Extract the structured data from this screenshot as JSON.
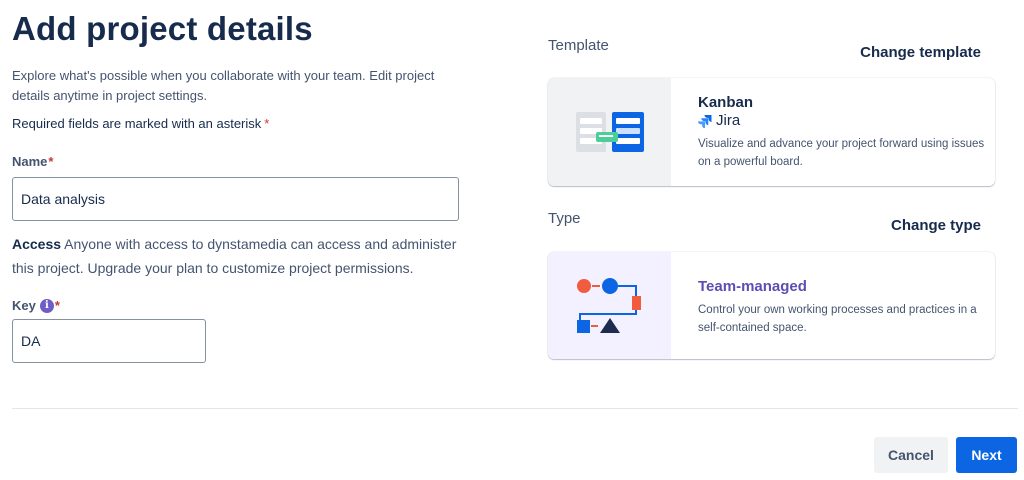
{
  "header": {
    "title": "Add project details",
    "intro": "Explore what's possible when you collaborate with your team. Edit project details anytime in project settings.",
    "required_note": "Required fields are marked with an asterisk",
    "asterisk": "*"
  },
  "form": {
    "name": {
      "label": "Name",
      "value": "Data analysis"
    },
    "access": {
      "label": "Access",
      "text": "Anyone with access to dynstamedia can access and administer this project. Upgrade your plan to customize project permissions."
    },
    "key": {
      "label": "Key",
      "value": "DA",
      "info_glyph": "i"
    }
  },
  "template": {
    "section_label": "Template",
    "change_label": "Change template",
    "card": {
      "title": "Kanban",
      "product": "Jira",
      "description": "Visualize and advance your project forward using issues on a powerful board."
    }
  },
  "type": {
    "section_label": "Type",
    "change_label": "Change type",
    "card": {
      "title": "Team-managed",
      "description": "Control your own working processes and practices in a self-contained space."
    }
  },
  "footer": {
    "cancel_label": "Cancel",
    "next_label": "Next"
  },
  "colors": {
    "primary": "#0c66e4",
    "asterisk": "#c9372c",
    "team_managed_title": "#5e4db2",
    "info_icon": "#6e5dc6"
  },
  "icons": {
    "info": "info-icon",
    "jira": "jira-logo-icon",
    "kanban": "kanban-illustration-icon",
    "team_managed": "team-managed-illustration-icon"
  }
}
